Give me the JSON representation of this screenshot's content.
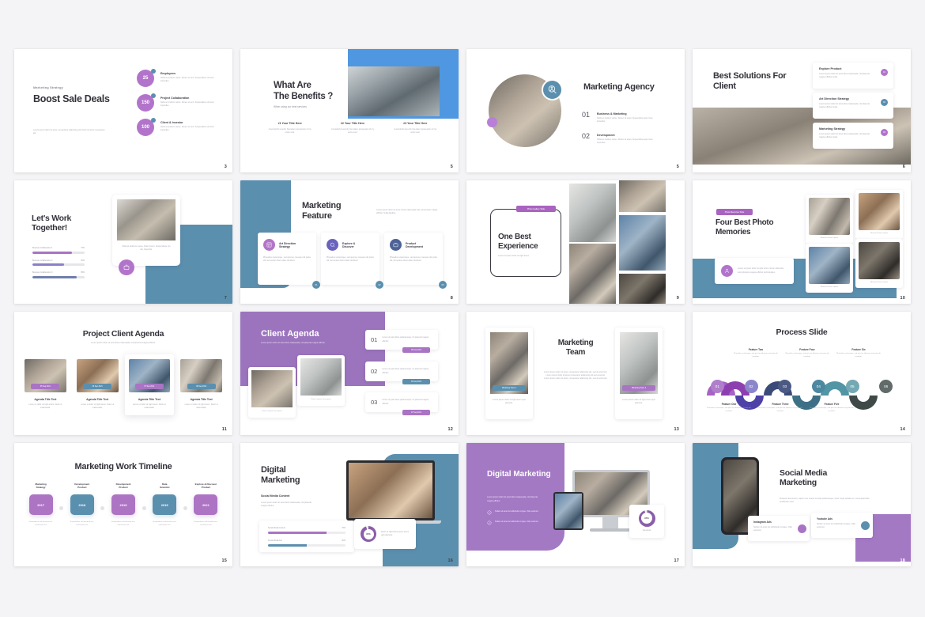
{
  "page": {
    "background": "#f4f4f6",
    "accent_purple": "#a974c4",
    "accent_blue": "#5b8fae",
    "accent_dark": "#33333b"
  },
  "slides": [
    {
      "number": "3",
      "name": "boost-sale-deals",
      "eyebrow": "Marketing Strategy",
      "title": "Boost Sale Deals",
      "body": "Lorem ipsum dolor sit amet, consectetur adipiscing elit. Dolor sit amet consectetur elit.",
      "stats": [
        {
          "value": "25",
          "label": "Employees",
          "desc": "Nulla ac pretium varius. Donec et sem. Suspendisse sit amet imperdiet."
        },
        {
          "value": "150",
          "label": "Project Collaboration",
          "desc": "Nulla ac pretium varius. Donec et sem. Suspendisse sit amet imperdiet."
        },
        {
          "value": "100",
          "label": "Client & Investor",
          "desc": "Nulla ac pretium varius. Donec et sem. Suspendisse sit amet imperdiet."
        }
      ]
    },
    {
      "number": "5",
      "name": "what-are-the-benefits",
      "title_l1": "What Are",
      "title_l2": "The Benefits ?",
      "subtitle": "When using our best services",
      "columns": [
        {
          "title": "#1 Your Title Here",
          "desc": "A wonderful serenity has taken possession of my entire soul."
        },
        {
          "title": "#2 Your Title Here",
          "desc": "A wonderful serenity has taken possession of my entire soul."
        },
        {
          "title": "#3 Your Title Here",
          "desc": "A wonderful serenity has taken possession of my entire soul."
        }
      ]
    },
    {
      "number": "5",
      "name": "marketing-agency",
      "title": "Marketing Agency",
      "items": [
        {
          "num": "01",
          "label": "Business & Marketing",
          "desc": "Nulla ac pretium varius. Donec sit amet. Suspendisse quis risus imperdiet."
        },
        {
          "num": "02",
          "label": "Development",
          "desc": "Nulla ac pretium varius. Donec sit amet. Suspendisse quis risus imperdiet."
        }
      ]
    },
    {
      "number": "6",
      "name": "best-solutions-for-client",
      "title_l1": "Best Solutions For",
      "title_l2": "Client",
      "cards": [
        {
          "title": "Explore Product",
          "desc": "Lorem ipsum dolor sit amet litora malesuada, nisl placerat magna efficitur turpis.",
          "dot": "01",
          "dot_color": "#a974c4"
        },
        {
          "title": "Art Direction Strategy",
          "desc": "Lorem ipsum dolor sit amet litora malesuada, nisl placerat magna efficitur turpis.",
          "dot": "02",
          "dot_color": "#5b8fae"
        },
        {
          "title": "Marketing Strategy",
          "desc": "Lorem ipsum dolor sit amet litora malesuada, nisl placerat magna efficitur turpis.",
          "dot": "03",
          "dot_color": "#a974c4"
        }
      ]
    },
    {
      "number": "7",
      "name": "lets-work-together",
      "title_l1": "Let's Work",
      "title_l2": "Together!",
      "bars": [
        {
          "label": "Business Collaboration 1",
          "value": "75%",
          "pct": 75,
          "color": "#a974c4"
        },
        {
          "label": "Business Collaboration 2",
          "value": "60%",
          "pct": 60,
          "color": "#8b80c8"
        },
        {
          "label": "Business Collaboration 3",
          "value": "85%",
          "pct": 85,
          "color": "#6e7fae"
        }
      ],
      "caption": "Nulla sit dolorum neque, Dolor ipsum. Suspendisse pro nisi, Nepethel.",
      "icon": "briefcase-icon"
    },
    {
      "number": "8",
      "name": "marketing-feature",
      "title_l1": "Marketing",
      "title_l2": "Feature",
      "intro": "Lorem ipsum dolor sit amet, litora malesuada cras consectetur magna efficitur. Nulla dapibus.",
      "features": [
        {
          "title_l1": "Art Direction",
          "title_l2": "Strategy",
          "desc": "Phasellus scelerisque, sed quis leo. Aenean nisl porta elit, fermentum libero diam tincidunt.",
          "color": "#b374c8",
          "icon": "layout-icon",
          "step": "01"
        },
        {
          "title_l1": "Explore &",
          "title_l2": "Discover",
          "desc": "Phasellus scelerisque, sed quis leo. Aenean nisl porta elit, fermentum libero diam tincidunt.",
          "color": "#6a63be",
          "icon": "search-icon",
          "step": "02"
        },
        {
          "title_l1": "Product",
          "title_l2": "Development",
          "desc": "Phasellus scelerisque, sed quis leo. Aenean nisl porta elit, fermentum libero diam tincidunt.",
          "color": "#4d6296",
          "icon": "briefcase-icon",
          "step": "03"
        }
      ]
    },
    {
      "number": "9",
      "name": "one-best-experience",
      "tag": "Photo Gallery Slide",
      "title_l1": "One Best",
      "title_l2": "Experience",
      "subtitle": "Lorem ut ipsum dolor sit right lorem"
    },
    {
      "number": "10",
      "name": "four-best-photo-memories",
      "tag": "Photo Memories Slide",
      "title_l1": "Four Best Photo",
      "title_l2": "Memories",
      "note": "Lorem ut ipsum dolor sit right lorem, litora nulla dolor justo pharetra magna efficitur technologies.",
      "icon": "group-icon",
      "captions": [
        "Moment Photo Caption",
        "Moment Photo Caption",
        "Moment Photo Caption",
        "Moment Photo Caption"
      ]
    },
    {
      "number": "11",
      "name": "project-client-agenda",
      "title": "Project Client Agenda",
      "subtitle": "Lorem ipsum dolor sit amet litora malesuada, nisl placerat magna efficitur.",
      "cards": [
        {
          "date": "05 Sep 2021",
          "date_color": "#a974c4",
          "title": "Agenda Title Text",
          "desc": "Lorem ut dolor sit right lorem. Dolor ut malesuada."
        },
        {
          "date": "06 Sep 2021",
          "date_color": "#5b8fae",
          "title": "Agenda Title Text",
          "desc": "Lorem ut dolor sit right lorem. Dolor ut malesuada."
        },
        {
          "date": "07 Sep 2021",
          "date_color": "#a974c4",
          "title": "Agenda Title Text",
          "desc": "Lorem ut dolor sit right lorem. Dolor ut malesuada."
        },
        {
          "date": "08 Sep 2021",
          "date_color": "#5b8fae",
          "title": "Agenda Title Text",
          "desc": "Lorem ut dolor sit right lorem. Dolor ut malesuada."
        }
      ]
    },
    {
      "number": "12",
      "name": "client-agenda",
      "title": "Client Agenda",
      "subtitle": "Lorem ipsum dolor sit amet litora malesuada, nisl placerat magna efficitur.",
      "photo_captions": [
        "Photo Caption Description",
        "Photo Caption Description"
      ],
      "rows": [
        {
          "num": "01",
          "desc": "Lorem ut justo litora pellentesque. Ut placerat magna efficitur.",
          "date": "05 Sep 2021",
          "date_color": "#a974c4"
        },
        {
          "num": "02",
          "desc": "Lorem ut justo litora pellentesque. Ut placerat magna efficitur.",
          "date": "06 Sep 2021",
          "date_color": "#5b8fae"
        },
        {
          "num": "03",
          "desc": "Lorem ut justo litora pellentesque. Ut placerat magna efficitur.",
          "date": "07 Sep 2021",
          "date_color": "#a974c4"
        }
      ]
    },
    {
      "number": "13",
      "name": "marketing-team",
      "title_l1": "Marketing",
      "title_l2": "Team",
      "body": "Lorem ipsum dolor sit amet, consectetur adipiscing elit, sed do eiusmod. Lorem ipsum dolor sit amet consectetur adipiscing elit sed eiusmod. Lorem ipsum dolor sit amet, consectetur adipiscing elit, sed do eiusmod.",
      "members": [
        {
          "tag": "Marketing Team 1",
          "tag_color": "#5b8fae",
          "caption": "Lorem ipsum dolor sit right lorem quis placerat."
        },
        {
          "tag": "Marketing Team 2",
          "tag_color": "#a974c4",
          "caption": "Lorem ipsum dolor sit right lorem quis placerat."
        }
      ]
    },
    {
      "number": "14",
      "name": "process-slide",
      "title": "Process Slide",
      "steps": [
        {
          "num": "01",
          "label": "Feature One",
          "desc": "Phasellus scelerisque, sed quis leo. Aenean nisl porta elit tincidunt.",
          "color": "#a663c4",
          "position": "bottom"
        },
        {
          "num": "02",
          "label": "Feature Two",
          "desc": "Phasellus scelerisque, sed quis leo. Aenean nisl porta elit tincidunt.",
          "color": "#4d41a8",
          "position": "top"
        },
        {
          "num": "03",
          "label": "Feature Three",
          "desc": "Phasellus scelerisque, sed quis leo. Aenean nisl porta elit tincidunt.",
          "color": "#3b4b77",
          "position": "bottom"
        },
        {
          "num": "04",
          "label": "Feature Four",
          "desc": "Phasellus scelerisque, sed quis leo. Aenean nisl porta elit tincidunt.",
          "color": "#3d7086",
          "position": "top"
        },
        {
          "num": "05",
          "label": "Feature Five",
          "desc": "Phasellus scelerisque, sed quis leo. Aenean nisl porta elit tincidunt.",
          "color": "#5295a5",
          "position": "bottom"
        },
        {
          "num": "06",
          "label": "Feature Six",
          "desc": "Phasellus scelerisque, sed quis leo. Aenean nisl porta elit tincidunt.",
          "color": "#3f4a48",
          "position": "top"
        }
      ]
    },
    {
      "number": "15",
      "name": "marketing-work-timeline",
      "title": "Marketing Work Timeline",
      "items": [
        {
          "heading_l1": "Marketing",
          "heading_l2": "Strategy",
          "year": "2017",
          "color": "#ad74c4",
          "desc": "Suspendisse sed tincidunt orci, sed laoreet nisl."
        },
        {
          "heading_l1": "Development",
          "heading_l2": "Product",
          "year": "2018",
          "color": "#5b8fae",
          "desc": "Suspendisse sed tincidunt orci, sed laoreet nisl."
        },
        {
          "heading_l1": "Development",
          "heading_l2": "Product",
          "year": "2019",
          "color": "#ad74c4",
          "desc": "Suspendisse sed tincidunt orci, sed laoreet nisl."
        },
        {
          "heading_l1": "Data",
          "heading_l2": "Scientist",
          "year": "2019",
          "color": "#5b8fae",
          "desc": "Suspendisse sed tincidunt orci, sed laoreet nisl."
        },
        {
          "heading_l1": "Explore & Discover",
          "heading_l2": "Product",
          "year": "2021",
          "color": "#ad74c4",
          "desc": "Suspendisse sed tincidunt orci, sed laoreet nisl."
        }
      ]
    },
    {
      "number": "16",
      "name": "digital-marketing-laptop",
      "title_l1": "Digital",
      "title_l2": "Marketing",
      "eyebrow": "Social Media Content",
      "body": "Lorem ipsum dolor sit amet litora malesuada, nisl placerat magna efficitur.",
      "bars": [
        {
          "label": "Social Media Content",
          "value": "75%",
          "pct": 75,
          "color": "#a974c4"
        },
        {
          "label": "Social Media Ads",
          "value": "50%",
          "pct": 50,
          "color": "#5b8fae"
        }
      ],
      "donut": {
        "value": "95%",
        "pct": 95,
        "color": "#8a5ea8"
      },
      "donut_note": "Dolor sit right litora ipsum lorem quis placerat."
    },
    {
      "number": "17",
      "name": "digital-marketing-desktop",
      "title": "Digital Marketing",
      "body": "Lorem ipsum dolor sit amet litora malesuada, nisl placerat magna efficitur.",
      "checks": [
        "Nullam sit amet dui sollicitudin congue. Odio euismod.",
        "Nullam sit amet dui sollicitudin congue. Odio euismod."
      ],
      "donut": {
        "value": "95%",
        "pct": 95,
        "color": "#8a5ea8",
        "caption": "Facebook"
      }
    },
    {
      "number": "18",
      "name": "social-media-marketing",
      "title_l1": "Social Media",
      "title_l2": "Marketing",
      "body": "Praesent fermentum, sapien nec viverra suscipit pellentesque, tortor turpis porttitor ex, consequat diam vestibulum enim.",
      "cards": [
        {
          "title": "Instagram Ads",
          "desc": "Nullam sit amet dui sollicitudin congue. Odio euismod.",
          "color": "#a974c4"
        },
        {
          "title": "Youtube Ads",
          "desc": "Nullam sit amet dui sollicitudin congue. Odio euismod.",
          "color": "#5b8fae"
        }
      ]
    }
  ]
}
